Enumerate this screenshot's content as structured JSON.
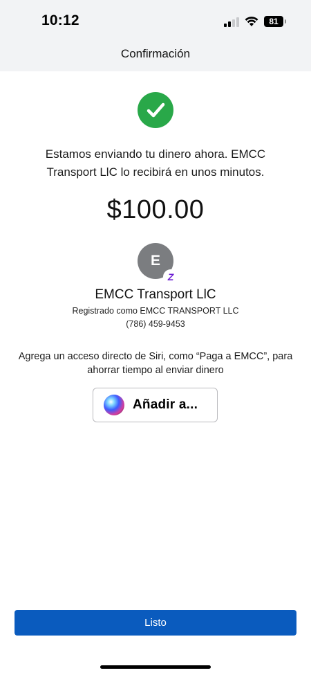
{
  "status_bar": {
    "time": "10:12",
    "battery_level": "81",
    "icons": [
      "cellular-signal-icon",
      "wifi-icon",
      "battery-icon"
    ]
  },
  "nav": {
    "title": "Confirmación"
  },
  "confirmation": {
    "icon": "check-circle-icon",
    "message": "Estamos enviando tu dinero ahora. EMCC Transport LlC lo recibirá en unos minutos.",
    "amount": "$100.00"
  },
  "recipient": {
    "initial": "E",
    "badge": "zelle-icon",
    "badge_glyph": "Z",
    "name": "EMCC Transport LlC",
    "registered_as": "Registrado como EMCC TRANSPORT LLC",
    "phone": "(786) 459-9453"
  },
  "siri": {
    "prompt": "Agrega un acceso directo de Siri, como “Paga a EMCC”, para ahorrar tiempo al enviar dinero",
    "button_label": "Añadir a...",
    "icon": "siri-icon"
  },
  "footer": {
    "done_label": "Listo"
  },
  "colors": {
    "success_green": "#29a849",
    "primary_blue": "#0a5bbe",
    "avatar_gray": "#7b7d80",
    "zelle_purple": "#6d1ed4",
    "header_bg": "#f2f3f5"
  }
}
